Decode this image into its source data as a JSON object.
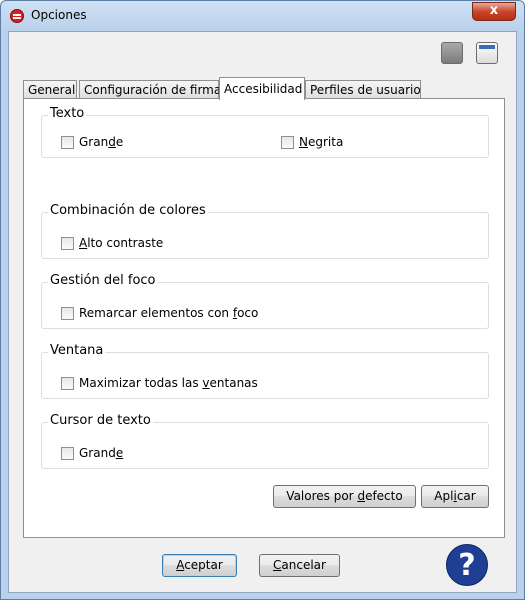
{
  "window": {
    "title": "Opciones",
    "close_glyph": "x"
  },
  "top_icons": [
    "gray-square-icon",
    "window-icon"
  ],
  "tabs": [
    {
      "label": "General"
    },
    {
      "label": "Configuración de firma"
    },
    {
      "label": "Accesibilidad",
      "active": true
    },
    {
      "label": "Perfiles de usuario"
    }
  ],
  "groups": {
    "texto": {
      "title": "Texto",
      "options": [
        {
          "pre": "Gran",
          "u": "d",
          "post": "e",
          "checked": false
        },
        {
          "pre": "",
          "u": "N",
          "post": "egrita",
          "checked": false
        }
      ]
    },
    "colores": {
      "title": "Combinación de colores",
      "options": [
        {
          "pre": "",
          "u": "A",
          "post": "lto contraste",
          "checked": false
        }
      ]
    },
    "foco": {
      "title": "Gestión del foco",
      "options": [
        {
          "pre": "Remarcar elementos con ",
          "u": "f",
          "post": "oco",
          "checked": false
        }
      ]
    },
    "ventana": {
      "title": "Ventana",
      "options": [
        {
          "pre": "Maximizar todas las ",
          "u": "v",
          "post": "entanas",
          "checked": false
        }
      ]
    },
    "cursor": {
      "title": "Cursor de texto",
      "options": [
        {
          "pre": "Grand",
          "u": "e",
          "post": "",
          "checked": false
        }
      ]
    }
  },
  "buttons": {
    "defaults": {
      "pre": "Valores por ",
      "u": "d",
      "post": "efecto"
    },
    "apply": {
      "pre": "Apl",
      "u": "i",
      "post": "car"
    },
    "accept": {
      "pre": "",
      "u": "A",
      "post": "ceptar"
    },
    "cancel": {
      "pre": "",
      "u": "C",
      "post": "ancelar"
    },
    "help_glyph": "?"
  }
}
